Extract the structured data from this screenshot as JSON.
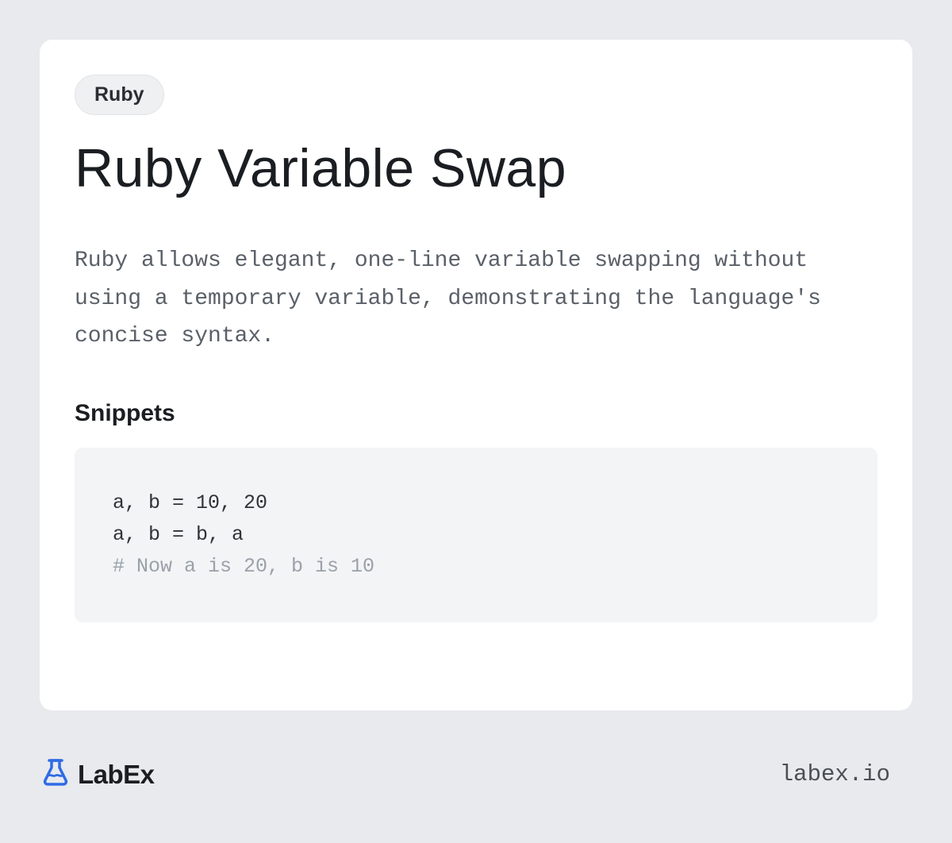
{
  "tag": "Ruby",
  "title": "Ruby Variable Swap",
  "description": "Ruby allows elegant, one-line variable swapping without using a temporary variable, demonstrating the language's concise syntax.",
  "section_heading": "Snippets",
  "code": {
    "line1": "a, b = 10, 20",
    "line2": "a, b = b, a",
    "comment": "# Now a is 20, b is 10"
  },
  "footer": {
    "brand": "LabEx",
    "url": "labex.io"
  }
}
